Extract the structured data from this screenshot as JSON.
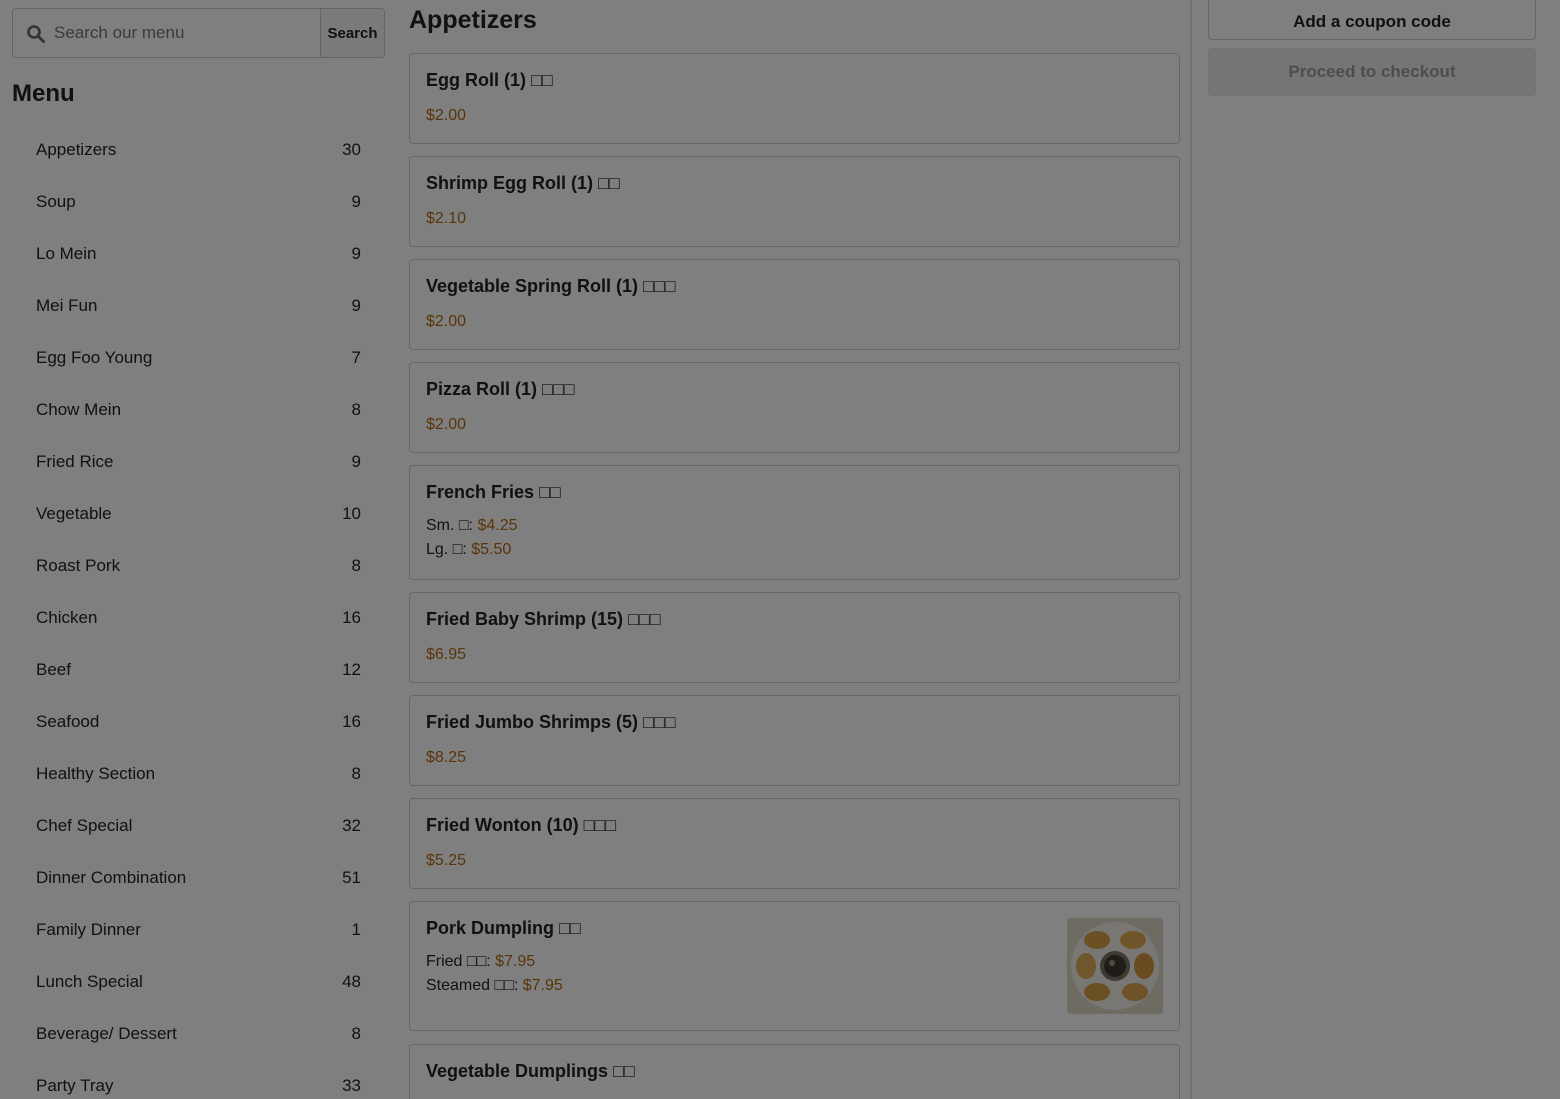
{
  "search": {
    "placeholder": "Search our menu",
    "button_label": "Search"
  },
  "menu": {
    "heading": "Menu",
    "categories": [
      {
        "name": "Appetizers",
        "count": "30"
      },
      {
        "name": "Soup",
        "count": "9"
      },
      {
        "name": "Lo Mein",
        "count": "9"
      },
      {
        "name": "Mei Fun",
        "count": "9"
      },
      {
        "name": "Egg Foo Young",
        "count": "7"
      },
      {
        "name": "Chow Mein",
        "count": "8"
      },
      {
        "name": "Fried Rice",
        "count": "9"
      },
      {
        "name": "Vegetable",
        "count": "10"
      },
      {
        "name": "Roast Pork",
        "count": "8"
      },
      {
        "name": "Chicken",
        "count": "16"
      },
      {
        "name": "Beef",
        "count": "12"
      },
      {
        "name": "Seafood",
        "count": "16"
      },
      {
        "name": "Healthy Section",
        "count": "8"
      },
      {
        "name": "Chef Special",
        "count": "32"
      },
      {
        "name": "Dinner Combination",
        "count": "51"
      },
      {
        "name": "Family Dinner",
        "count": "1"
      },
      {
        "name": "Lunch Special",
        "count": "48"
      },
      {
        "name": "Beverage/ Dessert",
        "count": "8"
      },
      {
        "name": "Party Tray",
        "count": "33"
      }
    ]
  },
  "section": {
    "title": "Appetizers",
    "items": [
      {
        "name": "Egg Roll (1) □□",
        "price": "$2.00"
      },
      {
        "name": "Shrimp Egg Roll (1) □□",
        "price": "$2.10"
      },
      {
        "name": "Vegetable Spring Roll (1) □□□",
        "price": "$2.00"
      },
      {
        "name": "Pizza Roll (1) □□□",
        "price": "$2.00"
      },
      {
        "name": "French Fries □□",
        "options": [
          {
            "label": "Sm. □:",
            "price": "$4.25"
          },
          {
            "label": "Lg. □:",
            "price": "$5.50"
          }
        ]
      },
      {
        "name": "Fried Baby Shrimp (15) □□□",
        "price": "$6.95"
      },
      {
        "name": "Fried Jumbo Shrimps (5) □□□",
        "price": "$8.25"
      },
      {
        "name": "Fried Wonton (10) □□□",
        "price": "$5.25"
      },
      {
        "name": "Pork Dumpling □□",
        "options": [
          {
            "label": "Fried □□:",
            "price": "$7.95"
          },
          {
            "label": "Steamed □□:",
            "price": "$7.95"
          }
        ]
      },
      {
        "name": "Vegetable Dumplings □□"
      }
    ]
  },
  "cart": {
    "coupon_label": "Add a coupon code",
    "checkout_label": "Proceed to checkout"
  },
  "colors": {
    "price": "#b36a12",
    "overlay": "rgba(0,0,0,0.5)",
    "border": "#cfcfcf"
  },
  "icons": {
    "search": "search-icon",
    "photo": "dumpling-photo"
  }
}
